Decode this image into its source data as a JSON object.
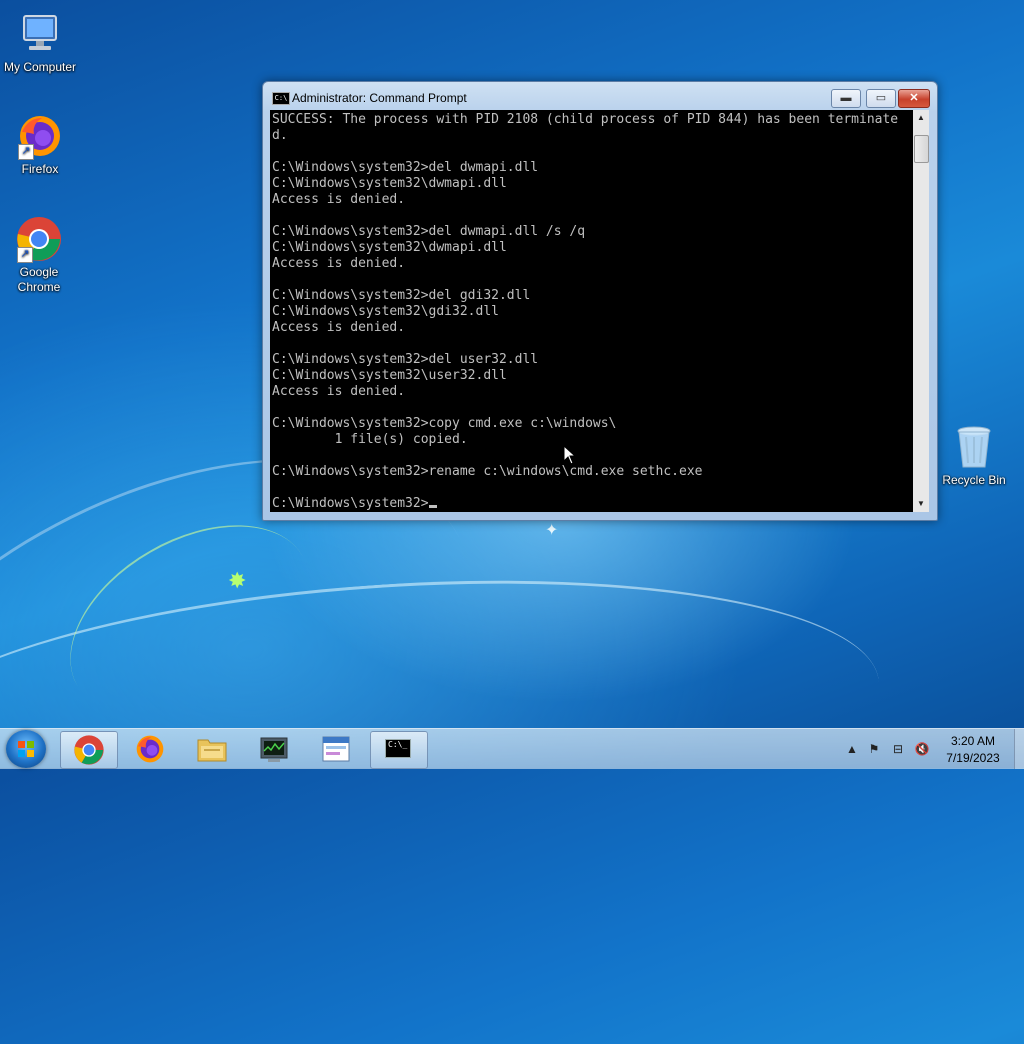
{
  "desktop": {
    "icons": [
      {
        "label": "My Computer"
      },
      {
        "label": "Firefox"
      },
      {
        "label": "Google Chrome"
      },
      {
        "label": "Recycle Bin"
      }
    ]
  },
  "window": {
    "title": "Administrator: Command Prompt",
    "buttons": {
      "minimize": "▬",
      "maximize": "▭",
      "close": "✕"
    }
  },
  "console": {
    "lines": [
      "SUCCESS: The process with PID 2108 (child process of PID 844) has been terminate",
      "d.",
      "",
      "C:\\Windows\\system32>del dwmapi.dll",
      "C:\\Windows\\system32\\dwmapi.dll",
      "Access is denied.",
      "",
      "C:\\Windows\\system32>del dwmapi.dll /s /q",
      "C:\\Windows\\system32\\dwmapi.dll",
      "Access is denied.",
      "",
      "C:\\Windows\\system32>del gdi32.dll",
      "C:\\Windows\\system32\\gdi32.dll",
      "Access is denied.",
      "",
      "C:\\Windows\\system32>del user32.dll",
      "C:\\Windows\\system32\\user32.dll",
      "Access is denied.",
      "",
      "C:\\Windows\\system32>copy cmd.exe c:\\windows\\",
      "        1 file(s) copied.",
      "",
      "C:\\Windows\\system32>rename c:\\windows\\cmd.exe sethc.exe",
      ""
    ],
    "prompt": "C:\\Windows\\system32>"
  },
  "taskbar": {
    "apps": [
      {
        "name": "chrome-icon"
      },
      {
        "name": "firefox-icon"
      },
      {
        "name": "file-explorer-icon"
      },
      {
        "name": "task-manager-icon"
      },
      {
        "name": "control-panel-icon"
      },
      {
        "name": "command-prompt-icon",
        "active": true
      }
    ],
    "clock": {
      "time": "3:20 AM",
      "date": "7/19/2023"
    }
  }
}
